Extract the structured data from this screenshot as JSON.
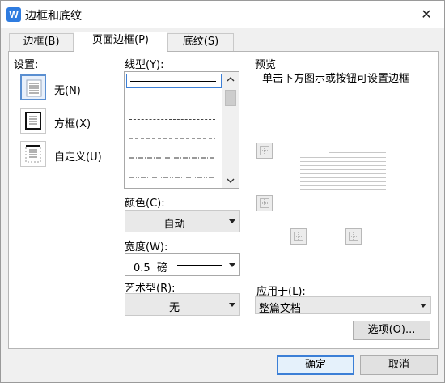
{
  "window": {
    "title": "边框和底纹",
    "app_icon": "W",
    "close_glyph": "✕"
  },
  "tabs": [
    {
      "label": "边框(B)",
      "active": false
    },
    {
      "label": "页面边框(P)",
      "active": true
    },
    {
      "label": "底纹(S)",
      "active": false
    }
  ],
  "settings": {
    "label": "设置:",
    "items": [
      {
        "label": "无(N)",
        "icon": "border-none-icon",
        "selected": true
      },
      {
        "label": "方框(X)",
        "icon": "border-box-icon",
        "selected": false
      },
      {
        "label": "自定义(U)",
        "icon": "border-custom-icon",
        "selected": false
      }
    ]
  },
  "line_style": {
    "label": "线型(Y):",
    "options": [
      "solid",
      "dotted-fine",
      "dashed-fine",
      "dashed",
      "dash-dot",
      "dash-dot-dot"
    ],
    "selected_index": 0
  },
  "color": {
    "label": "颜色(C):",
    "value": "自动"
  },
  "width": {
    "label": "宽度(W):",
    "value": "0.5  磅"
  },
  "art": {
    "label": "艺术型(R):",
    "value": "无"
  },
  "preview": {
    "label": "预览",
    "hint": "单击下方图示或按钮可设置边框"
  },
  "apply_to": {
    "label": "应用于(L):",
    "value": "整篇文档"
  },
  "options_button": "选项(O)...",
  "footer": {
    "ok": "确定",
    "cancel": "取消"
  },
  "colors": {
    "accent": "#3c7fd6",
    "app_icon": "#2f7ce0"
  }
}
